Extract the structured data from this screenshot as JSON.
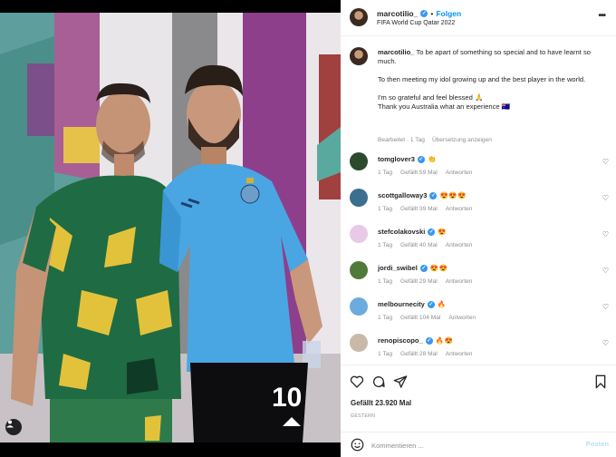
{
  "header": {
    "username": "marcotilio_",
    "separator": "•",
    "follow_label": "Folgen",
    "location": "FIFA World Cup Qatar 2022",
    "more_icon": "more-horizontal-icon"
  },
  "caption": {
    "username": "marcotilio_",
    "lines": [
      "To be apart of something so special and to have learnt so much.",
      "To then meeting my idol growing up and the best player in the world.",
      "I'm so grateful and feel blessed 🙏",
      "Thank you Australia what an experience 🇦🇺"
    ],
    "edited": "Bearbeitet · 1 Tag",
    "translate": "Übersetzung anzeigen"
  },
  "comments": [
    {
      "username": "tomglover3",
      "text": "👏",
      "time": "1 Tag",
      "likes": "Gefällt 59 Mal",
      "reply": "Antworten",
      "avatar_color": "#2b4a2e"
    },
    {
      "username": "scottgalloway3",
      "text": "😍😍😍",
      "time": "1 Tag",
      "likes": "Gefällt 39 Mal",
      "reply": "Antworten",
      "avatar_color": "#3b6e8f"
    },
    {
      "username": "stefcolakovski",
      "text": "😍",
      "time": "1 Tag",
      "likes": "Gefällt 40 Mal",
      "reply": "Antworten",
      "avatar_color": "#e8c9e6"
    },
    {
      "username": "jordi_swibel",
      "text": "😍😍",
      "time": "1 Tag",
      "likes": "Gefällt 29 Mal",
      "reply": "Antworten",
      "avatar_color": "#4f7a3a"
    },
    {
      "username": "melbournecity",
      "text": "🔥",
      "time": "1 Tag",
      "likes": "Gefällt 104 Mal",
      "reply": "Antworten",
      "avatar_color": "#6cabdd"
    },
    {
      "username": "renopiscopo_",
      "text": "🔥😍",
      "time": "1 Tag",
      "likes": "Gefällt 28 Mal",
      "reply": "Antworten",
      "avatar_color": "#c9b9a8"
    }
  ],
  "actions": {
    "likes": "Gefällt 23.920 Mal",
    "date": "GESTERN",
    "icons": [
      "heart-icon",
      "comment-icon",
      "share-icon",
      "bookmark-icon"
    ]
  },
  "add_comment": {
    "placeholder": "Kommentieren ...",
    "post_label": "Posten"
  },
  "colors": {
    "accent": "#0095f6",
    "verified": "#3897f0",
    "muted": "#8e8e8e"
  }
}
